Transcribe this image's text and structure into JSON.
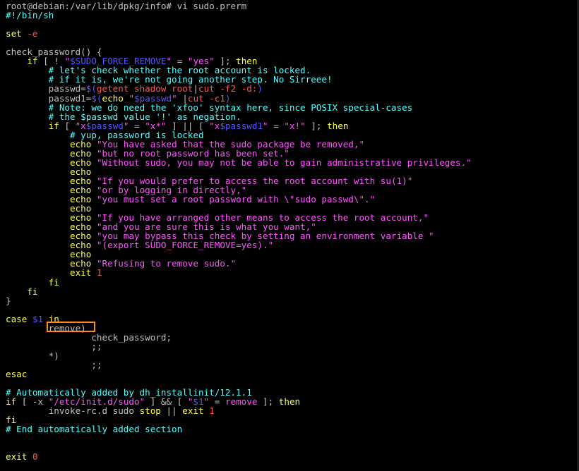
{
  "terminal": {
    "colors": {
      "default": "#c0c0c0",
      "keyword": "#ffff55",
      "string": "#ff55ff",
      "var": "#5555ff",
      "comment": "#55ffff",
      "option": "#ff5555",
      "number": "#ff5555",
      "cmd": "#ff5555",
      "highlight": "#ff8a1c",
      "background": "#000000"
    },
    "lines": [
      [
        [
          "default",
          "root@debian:/var/lib/dpkg/info# vi sudo.prerm"
        ]
      ],
      [
        [
          "comment",
          "#!/bin/sh"
        ]
      ],
      [],
      [
        [
          "keyword",
          "set "
        ],
        [
          "option",
          "-e"
        ]
      ],
      [],
      [
        [
          "default",
          "check_password() {"
        ]
      ],
      [
        [
          "default",
          "    "
        ],
        [
          "keyword",
          "if"
        ],
        [
          "default",
          " [ ! "
        ],
        [
          "string",
          "\""
        ],
        [
          "var",
          "$SUDO_FORCE_REMOVE"
        ],
        [
          "string",
          "\""
        ],
        [
          "default",
          " = "
        ],
        [
          "string",
          "\"yes\""
        ],
        [
          "default",
          " ]; "
        ],
        [
          "keyword",
          "then"
        ]
      ],
      [
        [
          "default",
          "        "
        ],
        [
          "comment",
          "# let's check whether the root account is locked."
        ]
      ],
      [
        [
          "default",
          "        "
        ],
        [
          "comment",
          "# if it is, we're not going another step. No Sirreee!"
        ]
      ],
      [
        [
          "default",
          "        passwd="
        ],
        [
          "var",
          "$("
        ],
        [
          "cmd",
          "getent shadow root"
        ],
        [
          "default",
          "|"
        ],
        [
          "cmd",
          "cut -f2 -d:"
        ],
        [
          "var",
          ")"
        ]
      ],
      [
        [
          "default",
          "        passwd1="
        ],
        [
          "var",
          "$("
        ],
        [
          "keyword",
          "echo"
        ],
        [
          "default",
          " "
        ],
        [
          "string",
          "\""
        ],
        [
          "var",
          "$passwd"
        ],
        [
          "string",
          "\""
        ],
        [
          "default",
          " |"
        ],
        [
          "cmd",
          "cut -c1"
        ],
        [
          "var",
          ")"
        ]
      ],
      [
        [
          "default",
          "        "
        ],
        [
          "comment",
          "# Note: we do need the 'xfoo' syntax here, since POSIX special-cases"
        ]
      ],
      [
        [
          "default",
          "        "
        ],
        [
          "comment",
          "# the $passwd value '!' as negation."
        ]
      ],
      [
        [
          "default",
          "        "
        ],
        [
          "keyword",
          "if"
        ],
        [
          "default",
          " [ "
        ],
        [
          "string",
          "\"x"
        ],
        [
          "var",
          "$passwd"
        ],
        [
          "string",
          "\""
        ],
        [
          "default",
          " = "
        ],
        [
          "string",
          "\"x*\""
        ],
        [
          "default",
          " ] || [ "
        ],
        [
          "string",
          "\"x"
        ],
        [
          "var",
          "$passwd1"
        ],
        [
          "string",
          "\""
        ],
        [
          "default",
          " = "
        ],
        [
          "string",
          "\"x!\""
        ],
        [
          "default",
          " ]; "
        ],
        [
          "keyword",
          "then"
        ]
      ],
      [
        [
          "default",
          "            "
        ],
        [
          "comment",
          "# yup, password is locked"
        ]
      ],
      [
        [
          "default",
          "            "
        ],
        [
          "keyword",
          "echo"
        ],
        [
          "default",
          " "
        ],
        [
          "string",
          "\"You have asked that the sudo package be removed,\""
        ]
      ],
      [
        [
          "default",
          "            "
        ],
        [
          "keyword",
          "echo"
        ],
        [
          "default",
          " "
        ],
        [
          "string",
          "\"but no root password has been set.\""
        ]
      ],
      [
        [
          "default",
          "            "
        ],
        [
          "keyword",
          "echo"
        ],
        [
          "default",
          " "
        ],
        [
          "string",
          "\"Without sudo, you may not be able to gain administrative privileges.\""
        ]
      ],
      [
        [
          "default",
          "            "
        ],
        [
          "keyword",
          "echo"
        ]
      ],
      [
        [
          "default",
          "            "
        ],
        [
          "keyword",
          "echo"
        ],
        [
          "default",
          " "
        ],
        [
          "string",
          "\"If you would prefer to access the root account with su(1)\""
        ]
      ],
      [
        [
          "default",
          "            "
        ],
        [
          "keyword",
          "echo"
        ],
        [
          "default",
          " "
        ],
        [
          "string",
          "\"or by logging in directly,\""
        ]
      ],
      [
        [
          "default",
          "            "
        ],
        [
          "keyword",
          "echo"
        ],
        [
          "default",
          " "
        ],
        [
          "string",
          "\"you must set a root password with \\\"sudo passwd\\\".\""
        ]
      ],
      [
        [
          "default",
          "            "
        ],
        [
          "keyword",
          "echo"
        ]
      ],
      [
        [
          "default",
          "            "
        ],
        [
          "keyword",
          "echo"
        ],
        [
          "default",
          " "
        ],
        [
          "string",
          "\"If you have arranged other means to access the root account,\""
        ]
      ],
      [
        [
          "default",
          "            "
        ],
        [
          "keyword",
          "echo"
        ],
        [
          "default",
          " "
        ],
        [
          "string",
          "\"and you are sure this is what you want,\""
        ]
      ],
      [
        [
          "default",
          "            "
        ],
        [
          "keyword",
          "echo"
        ],
        [
          "default",
          " "
        ],
        [
          "string",
          "\"you may bypass this check by setting an environment variable \""
        ]
      ],
      [
        [
          "default",
          "            "
        ],
        [
          "keyword",
          "echo"
        ],
        [
          "default",
          " "
        ],
        [
          "string",
          "\"(export SUDO_FORCE_REMOVE=yes).\""
        ]
      ],
      [
        [
          "default",
          "            "
        ],
        [
          "keyword",
          "echo"
        ]
      ],
      [
        [
          "default",
          "            "
        ],
        [
          "keyword",
          "echo"
        ],
        [
          "default",
          " "
        ],
        [
          "string",
          "\"Refusing to remove sudo.\""
        ]
      ],
      [
        [
          "default",
          "            "
        ],
        [
          "keyword",
          "exit"
        ],
        [
          "default",
          " "
        ],
        [
          "number",
          "1"
        ]
      ],
      [
        [
          "default",
          "        "
        ],
        [
          "keyword",
          "fi"
        ]
      ],
      [
        [
          "default",
          "    "
        ],
        [
          "keyword",
          "fi"
        ]
      ],
      [
        [
          "default",
          "}"
        ]
      ],
      [],
      [
        [
          "keyword",
          "case"
        ],
        [
          "default",
          " "
        ],
        [
          "var",
          "$1"
        ],
        [
          "default",
          " "
        ],
        [
          "keyword",
          "in"
        ]
      ],
      [
        [
          "default",
          "        remove)"
        ]
      ],
      [
        [
          "default",
          "                check_password;"
        ]
      ],
      [
        [
          "default",
          "                ;;"
        ]
      ],
      [
        [
          "default",
          "        *)"
        ]
      ],
      [
        [
          "default",
          "                ;;"
        ]
      ],
      [
        [
          "keyword",
          "esac"
        ]
      ],
      [],
      [
        [
          "comment",
          "# Automatically added by dh_installinit/12.1.1"
        ]
      ],
      [
        [
          "keyword",
          "if"
        ],
        [
          "default",
          " [ -x "
        ],
        [
          "string",
          "\"/etc/init.d/sudo\""
        ],
        [
          "default",
          " ] && [ "
        ],
        [
          "string",
          "\""
        ],
        [
          "var",
          "$1"
        ],
        [
          "string",
          "\""
        ],
        [
          "default",
          " = "
        ],
        [
          "string",
          "remove"
        ],
        [
          "default",
          " ]; "
        ],
        [
          "keyword",
          "then"
        ]
      ],
      [
        [
          "default",
          "        invoke-rc.d sudo "
        ],
        [
          "keyword",
          "stop"
        ],
        [
          "default",
          " || "
        ],
        [
          "keyword",
          "exit"
        ],
        [
          "default",
          " "
        ],
        [
          "number",
          "1"
        ]
      ],
      [
        [
          "keyword",
          "fi"
        ]
      ],
      [
        [
          "comment",
          "# End automatically added section"
        ]
      ],
      [],
      [],
      [
        [
          "keyword",
          "exit"
        ],
        [
          "default",
          " "
        ],
        [
          "number",
          "0"
        ]
      ]
    ]
  }
}
